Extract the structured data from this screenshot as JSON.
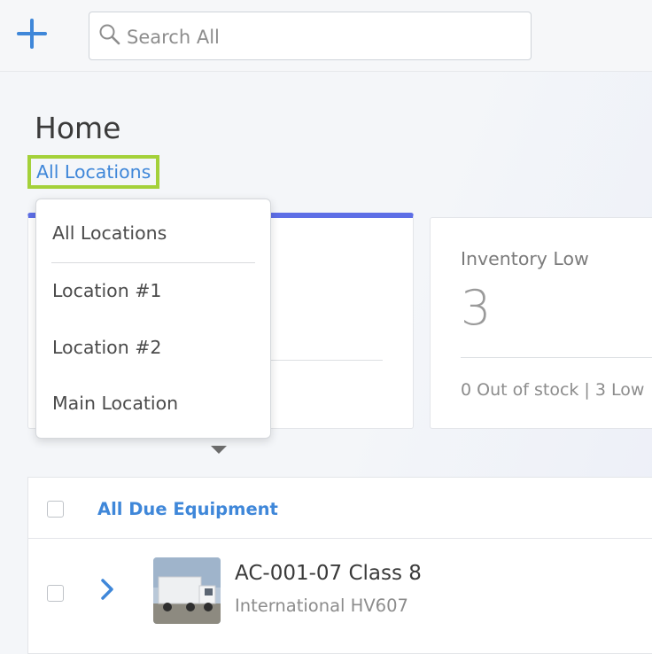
{
  "search": {
    "placeholder": "Search All"
  },
  "page": {
    "title": "Home"
  },
  "location_selector": {
    "current": "All Locations"
  },
  "location_menu": {
    "items": [
      "All Locations",
      "Location #1",
      "Location #2",
      "Main Location"
    ]
  },
  "cards": {
    "inventory_low": {
      "label": "Inventory Low",
      "value": "3",
      "summary": "0 Out of stock | 3 Low"
    }
  },
  "equipment_table": {
    "header": "All Due Equipment",
    "rows": [
      {
        "name": "AC-001-07 Class 8",
        "model": "International HV607"
      }
    ]
  },
  "colors": {
    "accent_blue": "#3f87d9",
    "highlight_green": "#a4d13a",
    "card_top_bar": "#5d6ee6"
  }
}
